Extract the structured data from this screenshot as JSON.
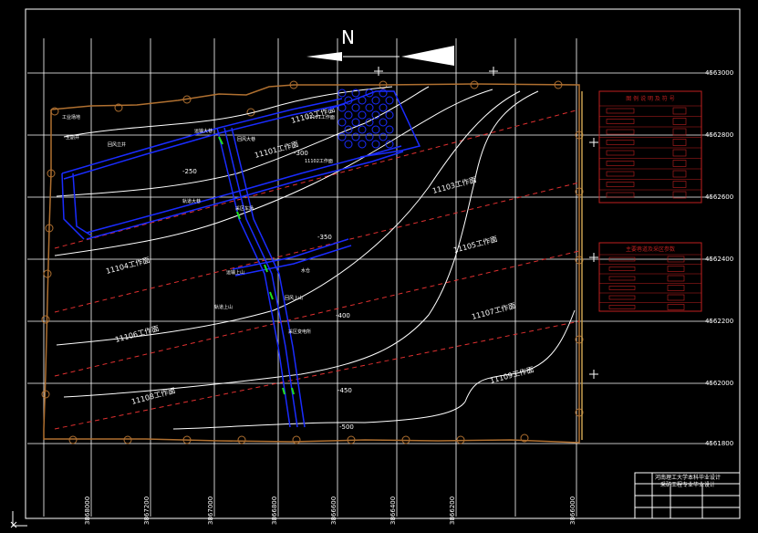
{
  "north_label": "N",
  "grid": {
    "x_labels": [
      "3868000",
      "3867200",
      "3867000",
      "3866800",
      "3866600",
      "3866400",
      "3866200",
      "3866000"
    ],
    "y_labels": [
      "4563000",
      "4562800",
      "4562600",
      "4562400",
      "4562200",
      "4562000",
      "4561800"
    ]
  },
  "workfaces": [
    {
      "label": "11102工作面"
    },
    {
      "label": "11101工作面"
    },
    {
      "label": "11103工作面"
    },
    {
      "label": "11104工作面"
    },
    {
      "label": "11105工作面"
    },
    {
      "label": "11106工作面"
    },
    {
      "label": "11107工作面"
    },
    {
      "label": "11108工作面"
    },
    {
      "label": "11109工作面"
    }
  ],
  "contours": [
    {
      "label": "-300"
    },
    {
      "label": "-250"
    },
    {
      "label": "-350"
    },
    {
      "label": "-400"
    },
    {
      "label": "-450"
    },
    {
      "label": "-500"
    }
  ],
  "roadway_labels": [
    {
      "text": "工业场地"
    },
    {
      "text": "主副井"
    },
    {
      "text": "回风立井"
    },
    {
      "text": "运输大巷"
    },
    {
      "text": "回风大巷"
    },
    {
      "text": "轨道大巷"
    },
    {
      "text": "采区车场"
    },
    {
      "text": "运输上山"
    },
    {
      "text": "轨道上山"
    },
    {
      "text": "回风上山"
    },
    {
      "text": "采区变电所"
    },
    {
      "text": "水仓"
    },
    {
      "text": "11101工作面"
    },
    {
      "text": "11102工作面"
    }
  ],
  "legend1_title": "图 例 说 明 及 符 号",
  "legend2_title": "主要巷道及采区参数",
  "title_block": {
    "line1": "河南理工大学本科毕业设计",
    "line2": "采矿工程专业毕业设计"
  },
  "colors": {
    "grid": "#ffffff",
    "boundary": "#b07030",
    "roadway": "#1a2cff",
    "cutline": "#e03030",
    "contour": "#ffffff",
    "legend": "#c02020"
  }
}
